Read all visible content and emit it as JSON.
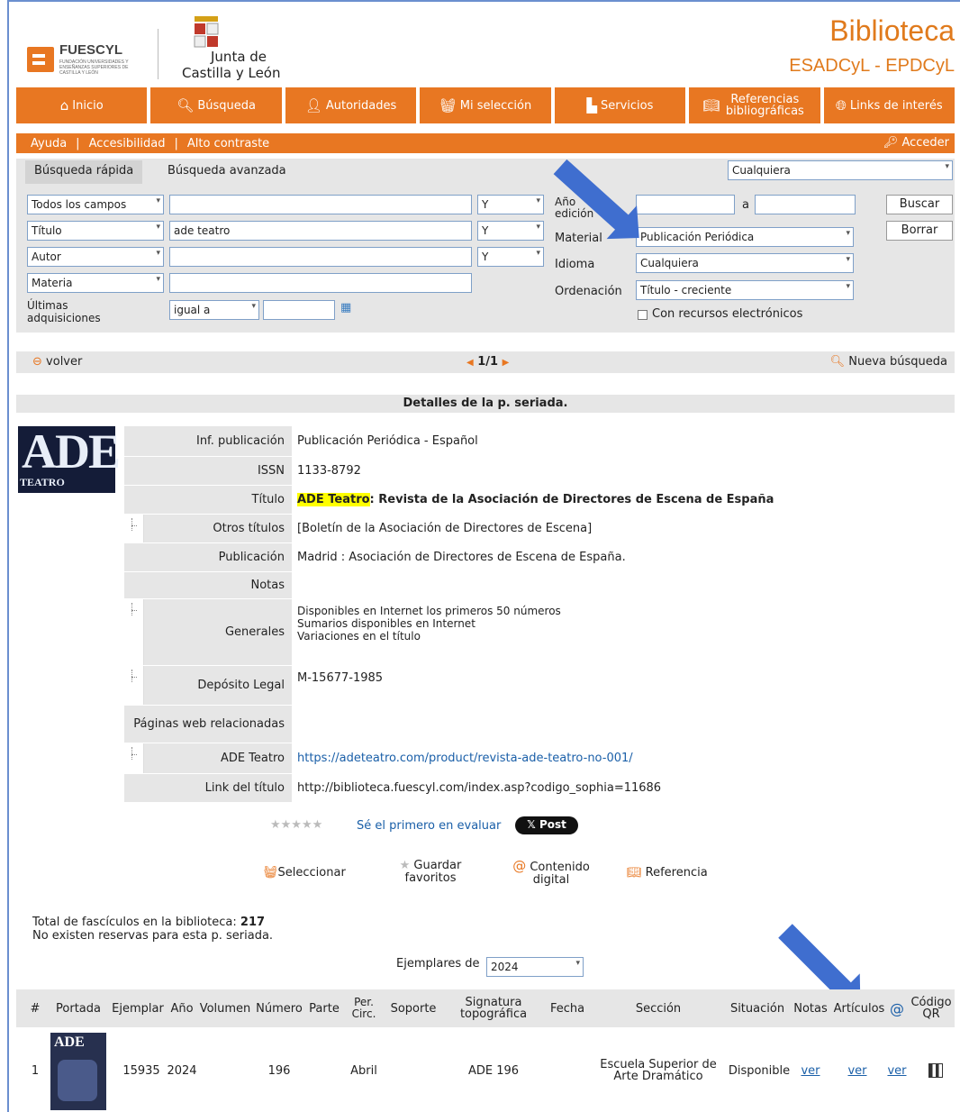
{
  "header": {
    "fuescyl": "FUESCYL",
    "fuescyl_sub": "FUNDACIÓN UNIVERSIDADES Y ENSEÑANZAS SUPERIORES DE CASTILLA Y LEÓN",
    "junta_line1": "Junta de",
    "junta_line2": "Castilla y León",
    "title": "Biblioteca",
    "subtitle": "ESADCyL - EPDCyL"
  },
  "nav": [
    {
      "icon": "home-icon",
      "label": "Inicio"
    },
    {
      "icon": "search-icon",
      "label": "Búsqueda"
    },
    {
      "icon": "users-icon",
      "label": "Autoridades"
    },
    {
      "icon": "basket-icon",
      "label": "Mi selección"
    },
    {
      "icon": "services-icon",
      "label": "Servicios"
    },
    {
      "icon": "book-icon",
      "label": "Referencias bibliográficas"
    },
    {
      "icon": "globe-icon",
      "label": "Links de interés"
    }
  ],
  "subbar": {
    "ayuda": "Ayuda",
    "accesibilidad": "Accesibilidad",
    "alto_contraste": "Alto contraste",
    "acceder": "Acceder",
    "separator": "|"
  },
  "search": {
    "tab_rapida": "Búsqueda rápida",
    "tab_avanzada": "Búsqueda avanzada",
    "scope": "Cualquiera",
    "field1": "Todos los campos",
    "field2": "Título",
    "field3": "Autor",
    "field4": "Materia",
    "value1": "",
    "value2": "ade teatro",
    "value3": "",
    "value4": "",
    "op1": "Y",
    "op2": "Y",
    "op3": "Y",
    "ultimas_label": "Últimas adquisiciones",
    "ultimas_op": "igual a",
    "ano_label": "Año edición",
    "ano_from": "",
    "ano_a": "a",
    "ano_to": "",
    "material_label": "Material",
    "material_value": "Publicación Periódica",
    "idioma_label": "Idioma",
    "idioma_value": "Cualquiera",
    "orden_label": "Ordenación",
    "orden_value": "Título - creciente",
    "electronicos_label": "Con recursos electrónicos",
    "buscar": "Buscar",
    "borrar": "Borrar"
  },
  "results_nav": {
    "volver": "volver",
    "page": "1/1",
    "nueva": "Nueva búsqueda"
  },
  "detail": {
    "heading": "Detalles de la p. seriada.",
    "cover_big": "ADE",
    "cover_small": "TEATRO",
    "rows": [
      {
        "label": "Inf. publicación",
        "value": "Publicación Periódica - Español"
      },
      {
        "label": "ISSN",
        "value": "1133-8792"
      },
      {
        "label": "Título",
        "value_hl": "ADE Teatro",
        "value_rest": " : Revista de la Asociación de Directores de Escena de España"
      },
      {
        "label": "Otros títulos",
        "value": "[Boletín de la Asociación de Directores de Escena]"
      },
      {
        "label": "Publicación",
        "value": "Madrid : Asociación de Directores de Escena de España."
      },
      {
        "label": "Notas",
        "value": ""
      },
      {
        "label": "Generales",
        "lines": [
          "Disponibles en Internet los primeros 50 números",
          "Sumarios disponibles en Internet",
          "Variaciones en el título"
        ]
      },
      {
        "label": "Depósito Legal",
        "value": "M-15677-1985"
      },
      {
        "label": "Páginas web relacionadas",
        "value": ""
      },
      {
        "label": "ADE Teatro",
        "value": "https://adeteatro.com/product/revista-ade-teatro-no-001/"
      },
      {
        "label": "Link del título",
        "value": "http://biblioteca.fuescyl.com/index.asp?codigo_sophia=11686"
      }
    ]
  },
  "rating": {
    "stars": "★★★★★",
    "eval": "Sé el primero en evaluar",
    "post": "𝕏 Post"
  },
  "actions": {
    "seleccionar": "Seleccionar",
    "guardar": "Guardar favoritos",
    "contenido": "Contenido digital",
    "referencia": "Referencia"
  },
  "totals": {
    "line1_prefix": "Total de fascículos en la biblioteca: ",
    "line1_count": "217",
    "line2": "No existen reservas para esta p. seriada.",
    "ejemplares_label": "Ejemplares de",
    "ejemplares_year": "2024"
  },
  "table": {
    "headers": [
      "#",
      "Portada",
      "Ejemplar",
      "Año",
      "Volumen",
      "Número",
      "Parte",
      "Per. Circ.",
      "Soporte",
      "Signatura topográfica",
      "Fecha",
      "Sección",
      "Situación",
      "Notas",
      "Artículos",
      "@",
      "Código QR"
    ],
    "row": {
      "num": "1",
      "ejemplar": "15935",
      "ano": "2024",
      "numero": "196",
      "fecha": "Abril",
      "signatura": "ADE 196",
      "seccion": "Escuela Superior de Arte Dramático",
      "situacion": "Disponible",
      "notas": "ver",
      "articulos": "ver",
      "at": "ver",
      "cover_text": "ADE"
    }
  }
}
